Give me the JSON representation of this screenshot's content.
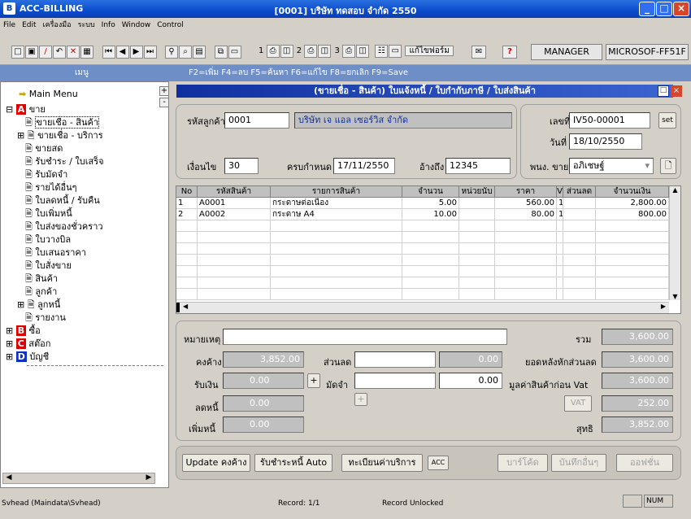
{
  "window": {
    "app_title": "ACC-BILLING",
    "doc_title": "[0001] บริษัท ทดสอบ จำกัด 2550"
  },
  "menu": [
    "File",
    "Edit",
    "เครื่องมือ",
    "ระบบ",
    "Info",
    "Window",
    "Control"
  ],
  "toolbar": {
    "user": "MANAGER",
    "computer": "MICROSOF-FF51F",
    "nums": [
      "1",
      "2",
      "3"
    ],
    "form_label": "แก้ไขฟอร์ม"
  },
  "fkeys": {
    "sidebar_label": "เมนู",
    "hints": "F2=เพิ่ม  F4=ลบ  F5=ค้นหา  F6=แก้ไข  F8=ยกเลิก  F9=Save"
  },
  "tree": {
    "main_menu": "Main Menu",
    "sale": "ขาย",
    "items": [
      "ขายเชื่อ - สินค้า",
      "ขายเชื่อ - บริการ",
      "ขายสด",
      "รับชำระ / ใบเสร็จ",
      "รับมัดจำ",
      "รายได้อื่นๆ",
      "ใบลดหนี้ / รับคืน",
      "ใบเพิ่มหนี้",
      "ใบส่งของชั่วคราว",
      "ใบวางบิล",
      "ใบเสนอราคา",
      "ใบสั่งขาย",
      "สินค้า",
      "ลูกค้า",
      "ลูกหนี้",
      "รายงาน"
    ],
    "buy": "ซื้อ",
    "stock": "สต๊อก",
    "account": "บัญชี"
  },
  "form": {
    "title": "(ขายเชื่อ - สินค้า)  ใบแจ้งหนี้ / ใบกำกับภาษี / ใบส่งสินค้า",
    "customer_code_label": "รหัสลูกค้า",
    "customer_code": "0001",
    "customer_name": "บริษัท เจ แอล เซอร์วิส จำกัด",
    "credit_label": "เงื่อนไข",
    "credit": "30",
    "due_label": "ครบกำหนด",
    "due": "17/11/2550",
    "ref_label": "อ้างถึง",
    "ref": "12345",
    "doc_no_label": "เลขที่",
    "doc_no": "IV50-00001",
    "set": "set",
    "date_label": "วันที่",
    "date": "18/10/2550",
    "sales_label": "พนง. ขาย",
    "sales": "อภิเชษฐ์"
  },
  "grid": {
    "headers": [
      "No",
      "รหัสสินค้า",
      "รายการสินค้า",
      "จำนวน",
      "หน่วยนับ",
      "ราคา",
      "V",
      "ส่วนลด",
      "จำนวนเงิน"
    ],
    "rows": [
      [
        "1",
        "A0001",
        "กระดาษต่อเนื่อง",
        "5.00",
        "",
        "560.00",
        "1",
        "",
        "2,800.00"
      ],
      [
        "2",
        "A0002",
        "กระดาษ A4",
        "10.00",
        "",
        "80.00",
        "1",
        "",
        "800.00"
      ]
    ]
  },
  "totals": {
    "remark_label": "หมายเหตุ",
    "remark": "",
    "total_label": "รวม",
    "total": "3,600.00",
    "balance_label": "คงค้าง",
    "balance": "3,852.00",
    "discount_label": "ส่วนลด",
    "discount": "",
    "discount_amt": "0.00",
    "after_disc_label": "ยอดหลังหักส่วนลด",
    "after_disc": "3,600.00",
    "receive_label": "รับเงิน",
    "receive": "0.00",
    "deposit_label": "มัดจำ",
    "deposit": "",
    "deposit_amt": "0.00",
    "before_vat_label": "มูลค่าสินค้าก่อน Vat",
    "before_vat": "3,600.00",
    "reduce_label": "ลดหนี้",
    "reduce": "0.00",
    "vat_button": "VAT",
    "vat": "252.00",
    "add_label": "เพิ่มหนี้",
    "add": "0.00",
    "net_label": "สุทธิ",
    "net": "3,852.00",
    "plus": "+"
  },
  "buttons": {
    "update": "Update คงค้าง",
    "auto_pay": "รับชำระหนี้ Auto",
    "register": "ทะเบียนค่าบริการ",
    "acc": "ACC",
    "barcode": "บาร์โค้ด",
    "save_other": "บันทึกอื่นๆ",
    "option": "ออฟชั่น"
  },
  "status": {
    "left": "Svhead (Maindata\\Svhead)",
    "record": "Record: 1/1",
    "lock": "Record Unlocked",
    "num": "NUM"
  }
}
